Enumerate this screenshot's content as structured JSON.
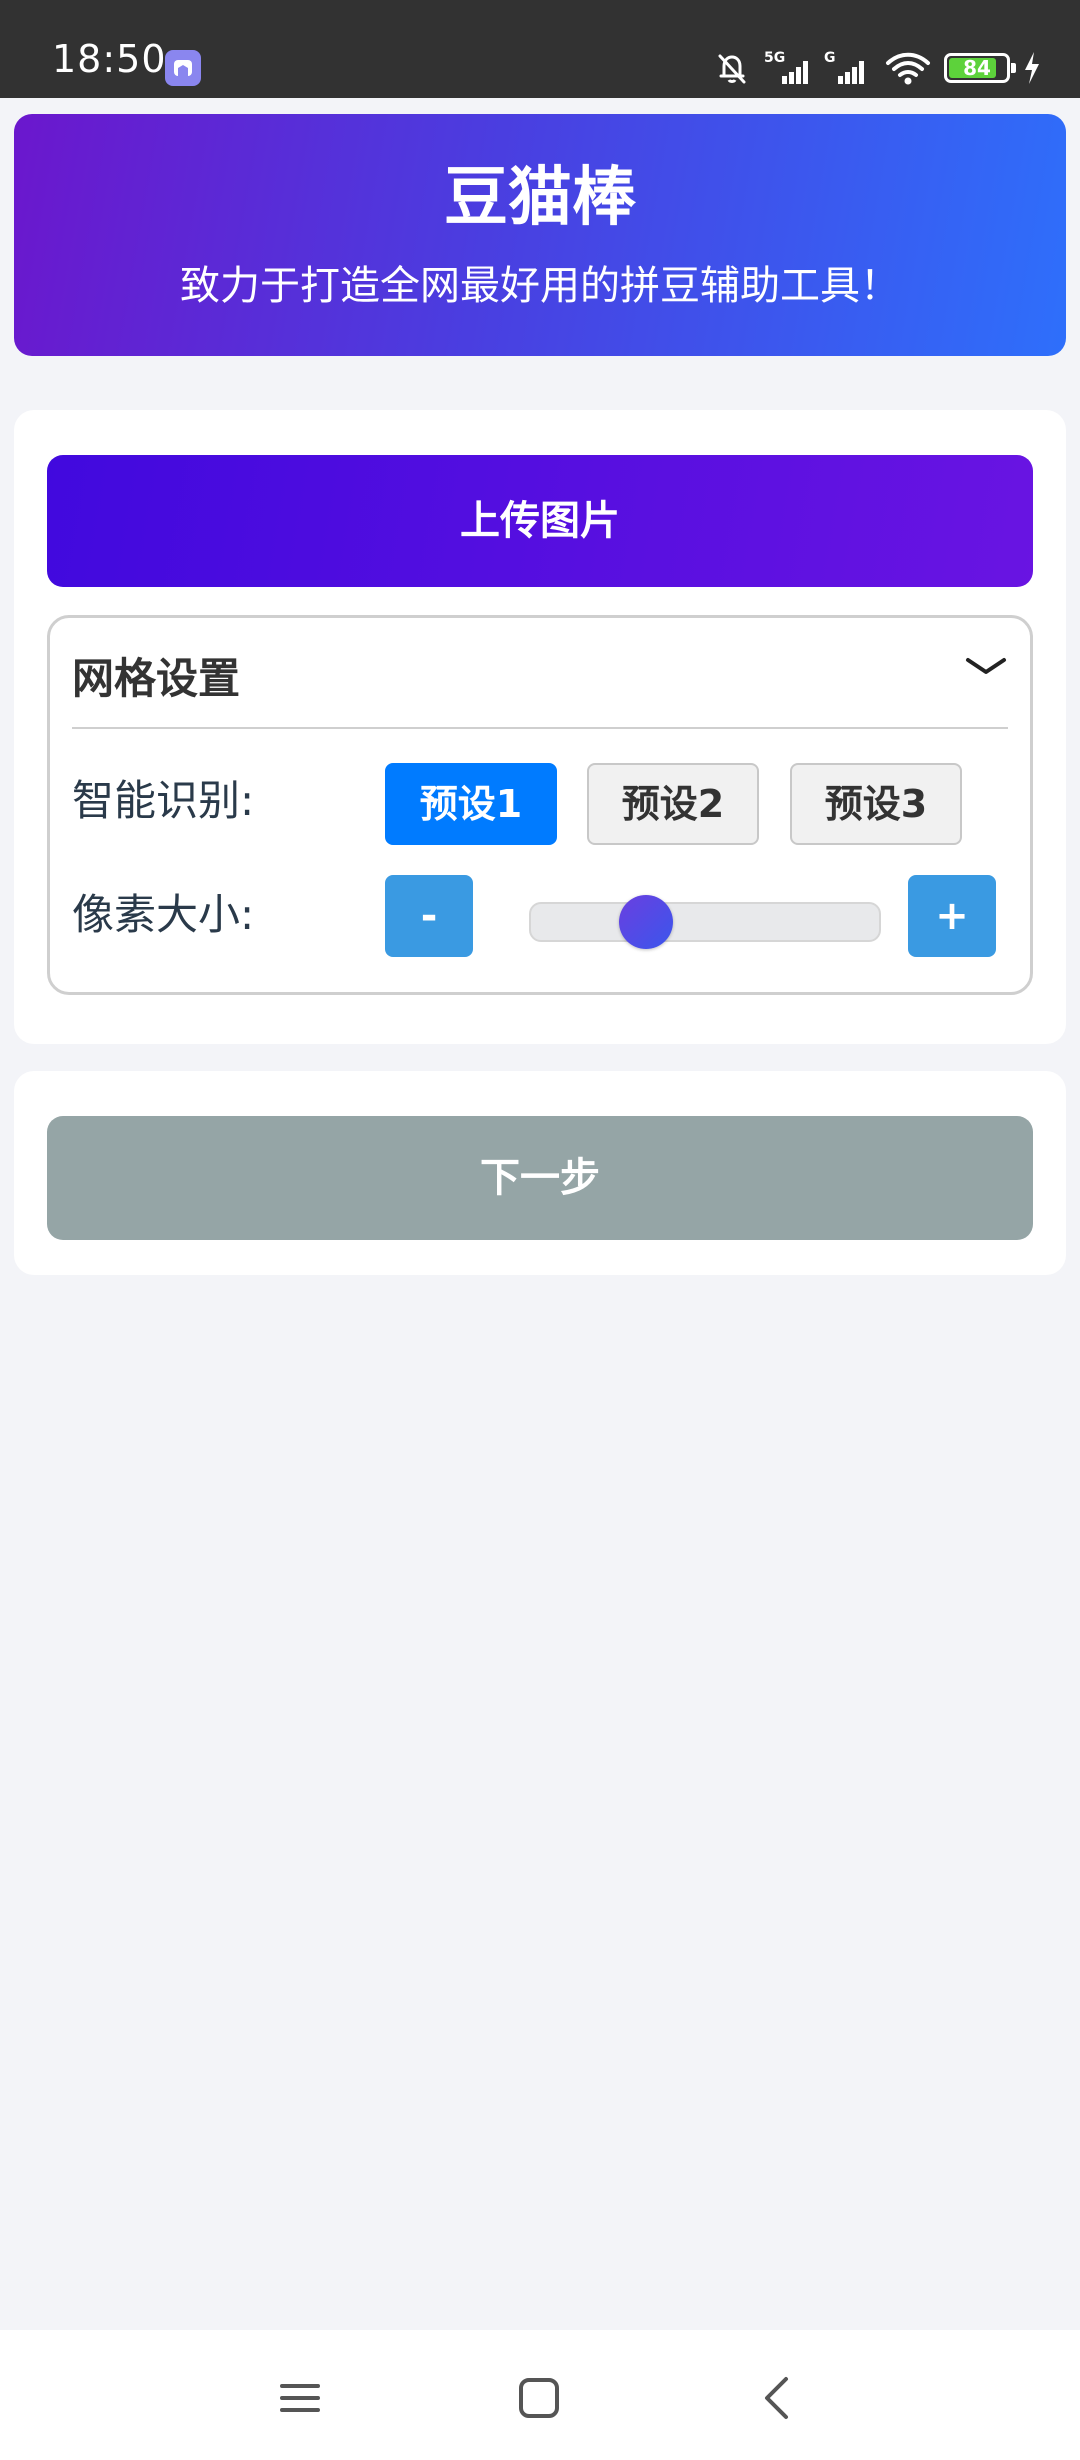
{
  "status_bar": {
    "time": "18:50",
    "battery_level": "84",
    "battery_fraction": 0.84,
    "icons": [
      "app-notification-icon",
      "bell-off-icon",
      "signal-5g-icon",
      "signal-g-icon",
      "wifi-icon",
      "battery-icon",
      "charging-icon"
    ]
  },
  "header": {
    "title": "豆猫棒",
    "subtitle": "致力于打造全网最好用的拼豆辅助工具！"
  },
  "upload": {
    "button_label": "上传图片"
  },
  "grid_settings": {
    "title": "网格设置",
    "collapse_icon": "chevron-down-icon",
    "recognition_label": "智能识别:",
    "presets": [
      "预设1",
      "预设2",
      "预设3"
    ],
    "active_preset": "预设1",
    "pixel_size_label": "像素大小:",
    "decrease_label": "-",
    "increase_label": "+",
    "pixel_size_slider_fraction": 0.33
  },
  "next": {
    "button_label": "下一步"
  },
  "nav_bar": {
    "icons": [
      "menu-icon",
      "home-icon",
      "back-icon"
    ]
  },
  "colors": {
    "header_gradient_start": "#6b17cd",
    "header_gradient_end": "#2e6ffb",
    "upload_gradient_start": "#4109de",
    "upload_gradient_end": "#6914e2",
    "active_preset": "#007bff",
    "step_button": "#3a9ae2",
    "next_button_disabled": "#95a5a6",
    "page_background": "#f3f4f8"
  }
}
